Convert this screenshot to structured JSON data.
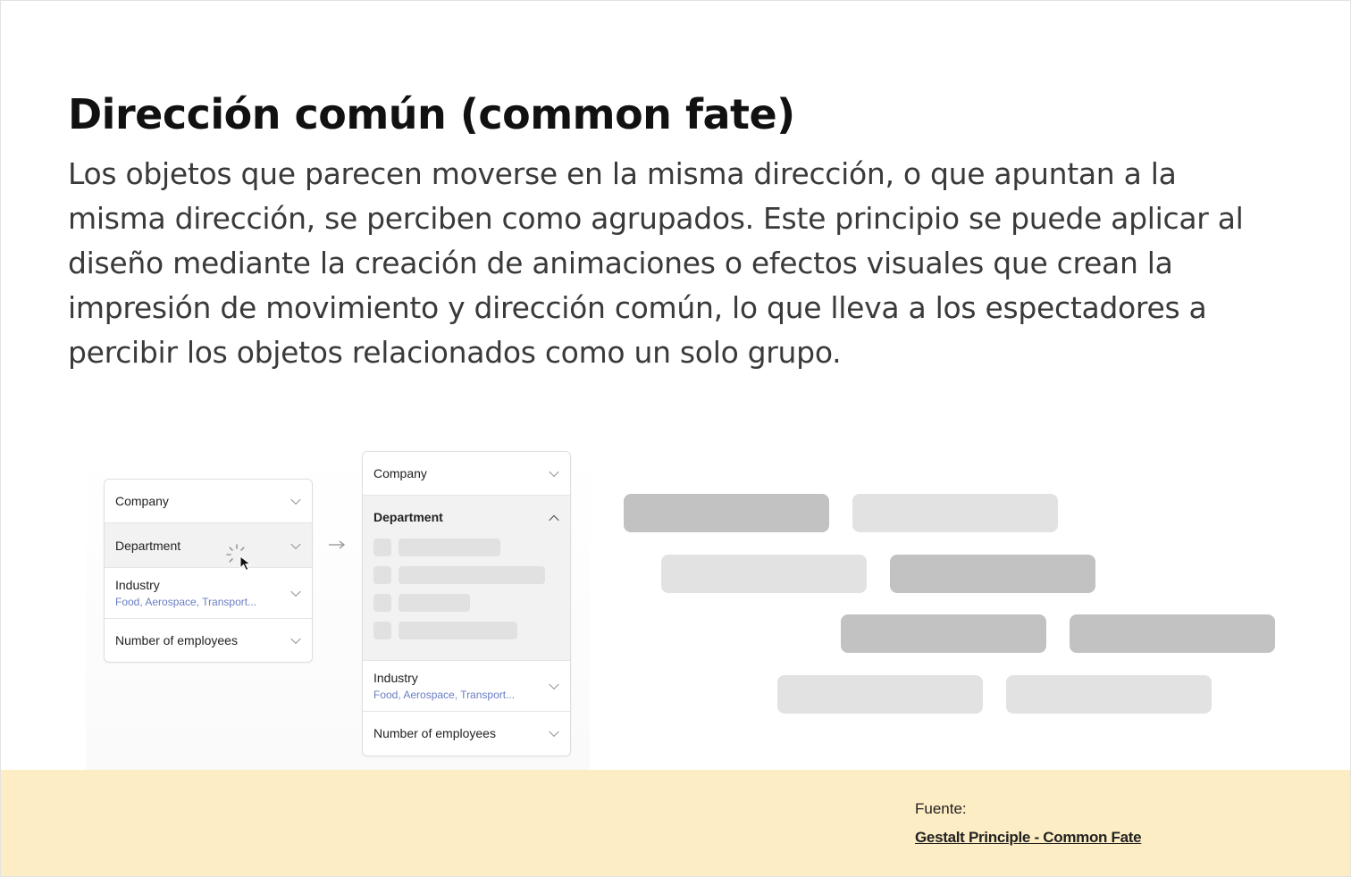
{
  "heading": "Dirección común (common fate)",
  "description": "Los objetos que parecen moverse en la misma dirección, o que apuntan a la misma dirección, se perciben como agrupados. Este principio se puede aplicar al diseño mediante la creación de animaciones o efectos visuales que crean la impresión de movimiento y dirección común, lo que lleva a los espectadores a percibir los objetos relacionados como un solo grupo.",
  "filter_before": {
    "company_label": "Company",
    "department_label": "Department",
    "industry_label": "Industry",
    "industry_value": "Food, Aerospace, Transport...",
    "employees_label": "Number of employees"
  },
  "filter_after": {
    "company_label": "Company",
    "department_label": "Department",
    "industry_label": "Industry",
    "industry_value": "Food, Aerospace, Transport...",
    "employees_label": "Number of employees"
  },
  "icons": {
    "chevron": "chevron-down-icon",
    "spinner": "loading-spinner-icon",
    "cursor": "mouse-pointer-icon",
    "arrow": "arrow-right-icon"
  },
  "colors": {
    "footer_bg": "#fdedc4",
    "pill_dark": "#c2c2c2",
    "pill_light": "#e2e2e2",
    "sub_text": "#6a7ec4"
  },
  "footer": {
    "source_label": "Fuente:",
    "source_link": "Gestalt Principle - Common Fate"
  }
}
